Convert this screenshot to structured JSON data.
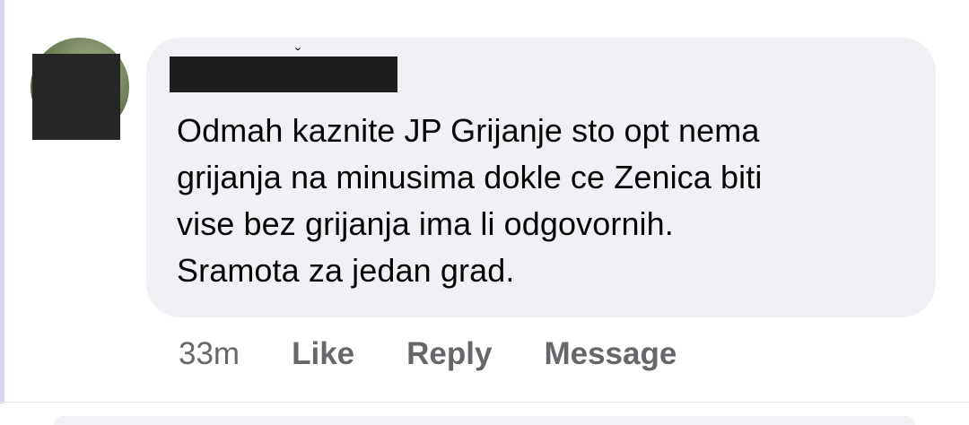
{
  "comment": {
    "author_mark": "ˇ",
    "lines": [
      "Odmah kaznite JP Grijanje sto opt nema",
      "grijanja na minusima dokle ce Zenica biti",
      "vise bez grijanja ima li odgovornih.",
      "Sramota za jedan grad."
    ]
  },
  "actions": {
    "time": "33m",
    "like": "Like",
    "reply": "Reply",
    "message": "Message"
  },
  "colors": {
    "bubble": "#eff1f4",
    "action_text": "#65676b",
    "comment_text": "#050505"
  }
}
